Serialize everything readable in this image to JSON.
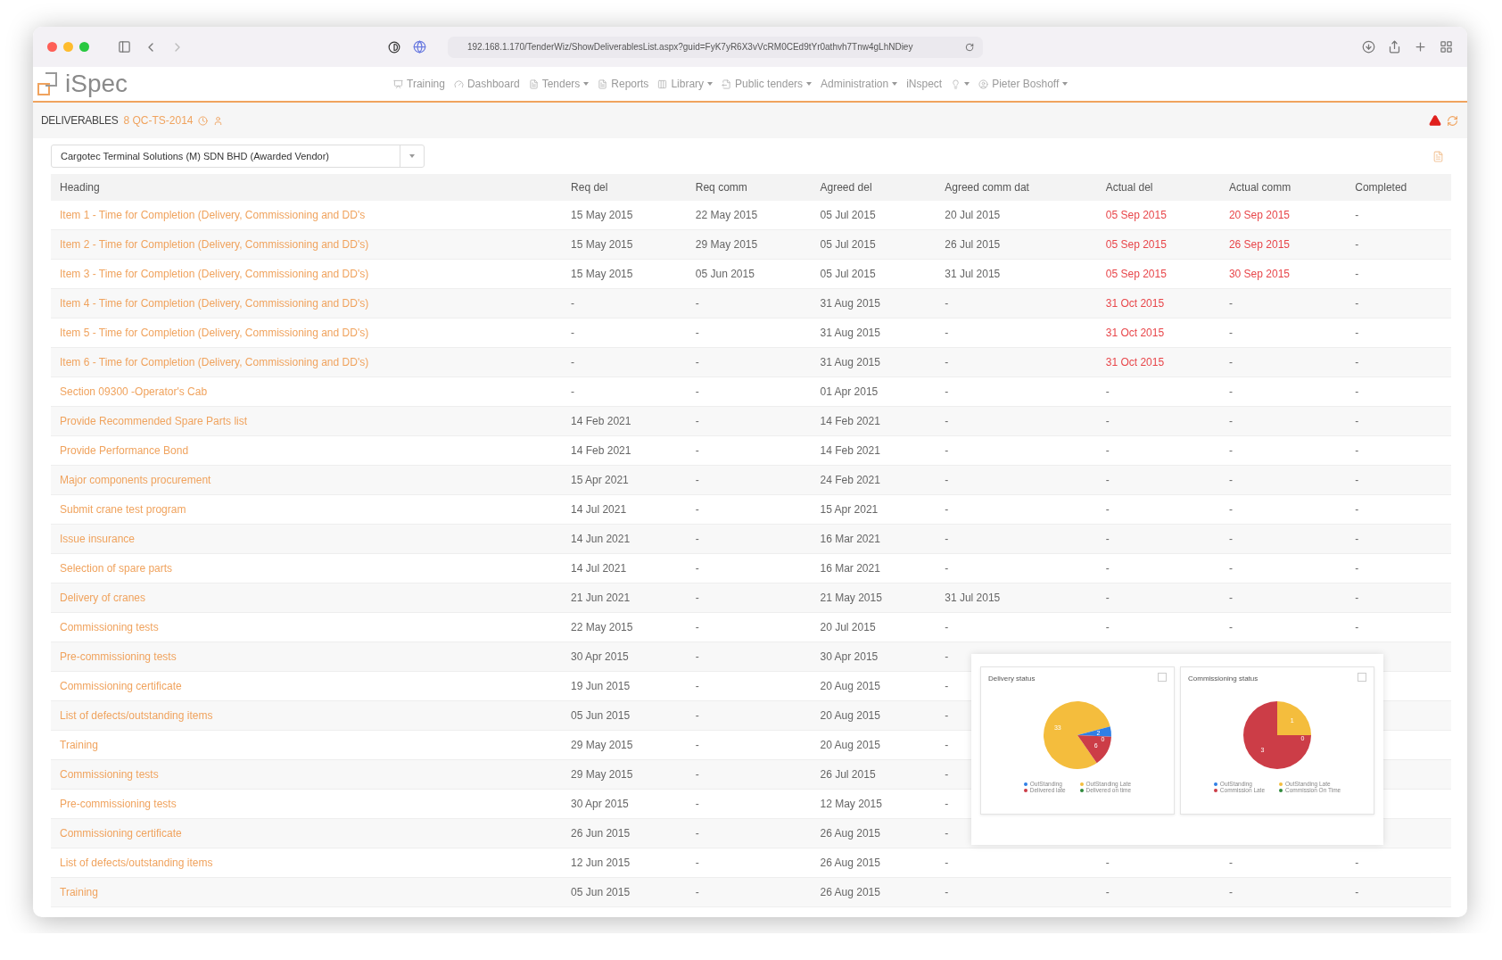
{
  "browser": {
    "url": "192.168.1.170/TenderWiz/ShowDeliverablesList.aspx?guid=FyK7yR6X3vVcRM0CEd9tYr0athvh7Tnw4gLhNDiey"
  },
  "nav": {
    "logo": "iSpec",
    "items": [
      {
        "label": "Training",
        "dropdown": false
      },
      {
        "label": "Dashboard",
        "dropdown": false
      },
      {
        "label": "Tenders",
        "dropdown": true
      },
      {
        "label": "Reports",
        "dropdown": false
      },
      {
        "label": "Library",
        "dropdown": true
      },
      {
        "label": "Public tenders",
        "dropdown": true
      },
      {
        "label": "Administration",
        "dropdown": true
      },
      {
        "label": "iNspect",
        "dropdown": false
      },
      {
        "dropdown": true
      },
      {
        "label": "Pieter Boshoff",
        "dropdown": true
      }
    ]
  },
  "page_header": {
    "title": "DELIVERABLES",
    "reference": "8 QC-TS-2014"
  },
  "vendor_select": {
    "value": "Cargotec Terminal Solutions (M) SDN BHD (Awarded Vendor)"
  },
  "table": {
    "heading_column": "Heading",
    "columns": [
      "Req del",
      "Req comm",
      "Agreed del",
      "Agreed comm dat",
      "Actual del",
      "Actual comm",
      "Completed"
    ],
    "rows": [
      {
        "heading": "Item 1 - Time for Completion (Delivery, Commissioning and DD's",
        "cells": [
          {
            "text": "15 May 2015",
            "overdue": false
          },
          {
            "text": "22 May 2015",
            "overdue": false
          },
          {
            "text": "05 Jul 2015",
            "overdue": false
          },
          {
            "text": "20 Jul 2015",
            "overdue": false
          },
          {
            "text": "05 Sep 2015",
            "overdue": true
          },
          {
            "text": "20 Sep 2015",
            "overdue": true
          },
          {
            "text": "-",
            "overdue": false
          }
        ]
      },
      {
        "heading": "Item 2 - Time for Completion (Delivery, Commissioning and DD's)",
        "cells": [
          {
            "text": "15 May 2015",
            "overdue": false
          },
          {
            "text": "29 May 2015",
            "overdue": false
          },
          {
            "text": "05 Jul 2015",
            "overdue": false
          },
          {
            "text": "26 Jul 2015",
            "overdue": false
          },
          {
            "text": "05 Sep 2015",
            "overdue": true
          },
          {
            "text": "26 Sep 2015",
            "overdue": true
          },
          {
            "text": "-",
            "overdue": false
          }
        ]
      },
      {
        "heading": "Item 3 - Time for Completion (Delivery, Commissioning and DD's)",
        "cells": [
          {
            "text": "15 May 2015",
            "overdue": false
          },
          {
            "text": "05 Jun 2015",
            "overdue": false
          },
          {
            "text": "05 Jul 2015",
            "overdue": false
          },
          {
            "text": "31 Jul 2015",
            "overdue": false
          },
          {
            "text": "05 Sep 2015",
            "overdue": true
          },
          {
            "text": "30 Sep 2015",
            "overdue": true
          },
          {
            "text": "-",
            "overdue": false
          }
        ]
      },
      {
        "heading": "Item 4 - Time for Completion (Delivery, Commissioning and DD's)",
        "cells": [
          {
            "text": "-",
            "overdue": false
          },
          {
            "text": "-",
            "overdue": false
          },
          {
            "text": "31 Aug 2015",
            "overdue": false
          },
          {
            "text": "-",
            "overdue": false
          },
          {
            "text": "31 Oct 2015",
            "overdue": true
          },
          {
            "text": "-",
            "overdue": false
          },
          {
            "text": "-",
            "overdue": false
          }
        ]
      },
      {
        "heading": "Item 5 - Time for Completion (Delivery, Commissioning and DD's)",
        "cells": [
          {
            "text": "-",
            "overdue": false
          },
          {
            "text": "-",
            "overdue": false
          },
          {
            "text": "31 Aug 2015",
            "overdue": false
          },
          {
            "text": "-",
            "overdue": false
          },
          {
            "text": "31 Oct 2015",
            "overdue": true
          },
          {
            "text": "-",
            "overdue": false
          },
          {
            "text": "-",
            "overdue": false
          }
        ]
      },
      {
        "heading": "Item 6 - Time for Completion (Delivery, Commissioning and DD's)",
        "cells": [
          {
            "text": "-",
            "overdue": false
          },
          {
            "text": "-",
            "overdue": false
          },
          {
            "text": "31 Aug 2015",
            "overdue": false
          },
          {
            "text": "-",
            "overdue": false
          },
          {
            "text": "31 Oct 2015",
            "overdue": true
          },
          {
            "text": "-",
            "overdue": false
          },
          {
            "text": "-",
            "overdue": false
          }
        ]
      },
      {
        "heading": "Section 09300 -Operator's Cab",
        "cells": [
          {
            "text": "-",
            "overdue": false
          },
          {
            "text": "-",
            "overdue": false
          },
          {
            "text": "01 Apr 2015",
            "overdue": false
          },
          {
            "text": "-",
            "overdue": false
          },
          {
            "text": "-",
            "overdue": false
          },
          {
            "text": "-",
            "overdue": false
          },
          {
            "text": "-",
            "overdue": false
          }
        ]
      },
      {
        "heading": "Provide Recommended Spare Parts list",
        "cells": [
          {
            "text": "14 Feb 2021",
            "overdue": false
          },
          {
            "text": "-",
            "overdue": false
          },
          {
            "text": "14 Feb 2021",
            "overdue": false
          },
          {
            "text": "-",
            "overdue": false
          },
          {
            "text": "-",
            "overdue": false
          },
          {
            "text": "-",
            "overdue": false
          },
          {
            "text": "-",
            "overdue": false
          }
        ]
      },
      {
        "heading": "Provide Performance Bond",
        "cells": [
          {
            "text": "14 Feb 2021",
            "overdue": false
          },
          {
            "text": "-",
            "overdue": false
          },
          {
            "text": "14 Feb 2021",
            "overdue": false
          },
          {
            "text": "-",
            "overdue": false
          },
          {
            "text": "-",
            "overdue": false
          },
          {
            "text": "-",
            "overdue": false
          },
          {
            "text": "-",
            "overdue": false
          }
        ]
      },
      {
        "heading": "Major components procurement",
        "cells": [
          {
            "text": "15 Apr 2021",
            "overdue": false
          },
          {
            "text": "-",
            "overdue": false
          },
          {
            "text": "24 Feb 2021",
            "overdue": false
          },
          {
            "text": "-",
            "overdue": false
          },
          {
            "text": "-",
            "overdue": false
          },
          {
            "text": "-",
            "overdue": false
          },
          {
            "text": "-",
            "overdue": false
          }
        ]
      },
      {
        "heading": "Submit crane test program",
        "cells": [
          {
            "text": "14 Jul 2021",
            "overdue": false
          },
          {
            "text": "-",
            "overdue": false
          },
          {
            "text": "15 Apr 2021",
            "overdue": false
          },
          {
            "text": "-",
            "overdue": false
          },
          {
            "text": "-",
            "overdue": false
          },
          {
            "text": "-",
            "overdue": false
          },
          {
            "text": "-",
            "overdue": false
          }
        ]
      },
      {
        "heading": "Issue insurance",
        "cells": [
          {
            "text": "14 Jun 2021",
            "overdue": false
          },
          {
            "text": "-",
            "overdue": false
          },
          {
            "text": "16 Mar 2021",
            "overdue": false
          },
          {
            "text": "-",
            "overdue": false
          },
          {
            "text": "-",
            "overdue": false
          },
          {
            "text": "-",
            "overdue": false
          },
          {
            "text": "-",
            "overdue": false
          }
        ]
      },
      {
        "heading": "Selection of spare parts",
        "cells": [
          {
            "text": "14 Jul 2021",
            "overdue": false
          },
          {
            "text": "-",
            "overdue": false
          },
          {
            "text": "16 Mar 2021",
            "overdue": false
          },
          {
            "text": "-",
            "overdue": false
          },
          {
            "text": "-",
            "overdue": false
          },
          {
            "text": "-",
            "overdue": false
          },
          {
            "text": "-",
            "overdue": false
          }
        ]
      },
      {
        "heading": "Delivery of cranes",
        "cells": [
          {
            "text": "21 Jun 2021",
            "overdue": false
          },
          {
            "text": "-",
            "overdue": false
          },
          {
            "text": "21 May 2015",
            "overdue": false
          },
          {
            "text": "31 Jul 2015",
            "overdue": false
          },
          {
            "text": "-",
            "overdue": false
          },
          {
            "text": "-",
            "overdue": false
          },
          {
            "text": "-",
            "overdue": false
          }
        ]
      },
      {
        "heading": "Commissioning tests",
        "cells": [
          {
            "text": "22 May 2015",
            "overdue": false
          },
          {
            "text": "-",
            "overdue": false
          },
          {
            "text": "20 Jul 2015",
            "overdue": false
          },
          {
            "text": "-",
            "overdue": false
          },
          {
            "text": "-",
            "overdue": false
          },
          {
            "text": "-",
            "overdue": false
          },
          {
            "text": "-",
            "overdue": false
          }
        ]
      },
      {
        "heading": "Pre-commissioning tests",
        "cells": [
          {
            "text": "30 Apr 2015",
            "overdue": false
          },
          {
            "text": "-",
            "overdue": false
          },
          {
            "text": "30 Apr 2015",
            "overdue": false
          },
          {
            "text": "-",
            "overdue": false
          }
        ]
      },
      {
        "heading": "Commissioning certificate",
        "cells": [
          {
            "text": "19 Jun 2015",
            "overdue": false
          },
          {
            "text": "-",
            "overdue": false
          },
          {
            "text": "20 Aug 2015",
            "overdue": false
          },
          {
            "text": "-",
            "overdue": false
          }
        ]
      },
      {
        "heading": "List of defects/outstanding items",
        "cells": [
          {
            "text": "05 Jun 2015",
            "overdue": false
          },
          {
            "text": "-",
            "overdue": false
          },
          {
            "text": "20 Aug 2015",
            "overdue": false
          },
          {
            "text": "-",
            "overdue": false
          }
        ]
      },
      {
        "heading": "Training",
        "cells": [
          {
            "text": "29 May 2015",
            "overdue": false
          },
          {
            "text": "-",
            "overdue": false
          },
          {
            "text": "20 Aug 2015",
            "overdue": false
          },
          {
            "text": "-",
            "overdue": false
          }
        ]
      },
      {
        "heading": "Commissioning tests",
        "cells": [
          {
            "text": "29 May 2015",
            "overdue": false
          },
          {
            "text": "-",
            "overdue": false
          },
          {
            "text": "26 Jul 2015",
            "overdue": false
          },
          {
            "text": "-",
            "overdue": false
          }
        ]
      },
      {
        "heading": "Pre-commissioning tests",
        "cells": [
          {
            "text": "30 Apr 2015",
            "overdue": false
          },
          {
            "text": "-",
            "overdue": false
          },
          {
            "text": "12 May 2015",
            "overdue": false
          },
          {
            "text": "-",
            "overdue": false
          }
        ]
      },
      {
        "heading": "Commissioning certificate",
        "cells": [
          {
            "text": "26 Jun 2015",
            "overdue": false
          },
          {
            "text": "-",
            "overdue": false
          },
          {
            "text": "26 Aug 2015",
            "overdue": false
          },
          {
            "text": "-",
            "overdue": false
          }
        ]
      },
      {
        "heading": "List of defects/outstanding items",
        "cells": [
          {
            "text": "12 Jun 2015",
            "overdue": false
          },
          {
            "text": "-",
            "overdue": false
          },
          {
            "text": "26 Aug 2015",
            "overdue": false
          },
          {
            "text": "-",
            "overdue": false
          },
          {
            "text": "-",
            "overdue": false
          },
          {
            "text": "-",
            "overdue": false
          },
          {
            "text": "-",
            "overdue": false
          }
        ]
      },
      {
        "heading": "Training",
        "cells": [
          {
            "text": "05 Jun 2015",
            "overdue": false
          },
          {
            "text": "-",
            "overdue": false
          },
          {
            "text": "26 Aug 2015",
            "overdue": false
          },
          {
            "text": "-",
            "overdue": false
          },
          {
            "text": "-",
            "overdue": false
          },
          {
            "text": "-",
            "overdue": false
          },
          {
            "text": "-",
            "overdue": false
          }
        ]
      }
    ]
  },
  "charts_panel": [
    {
      "chart_data": {
        "type": "pie",
        "title": "Delivery status",
        "categories": [
          "OutStanding",
          "OutStanding Late",
          "Delivered late",
          "Delivered on time"
        ],
        "values": [
          2,
          33,
          6,
          0
        ],
        "value_labels": [
          "2",
          "33",
          "6",
          "0"
        ],
        "colors": [
          "#2f7fe6",
          "#f4bd3d",
          "#cc3d47",
          "#2f8a3c"
        ]
      }
    },
    {
      "chart_data": {
        "type": "pie",
        "title": "Commissioning status",
        "categories": [
          "OutStanding",
          "OutStanding Late",
          "Commission Late",
          "Commission On Time"
        ],
        "values": [
          0,
          1,
          3,
          0
        ],
        "value_labels": [
          null,
          "1",
          "3",
          "0"
        ],
        "colors": [
          "#2f7fe6",
          "#f4bd3d",
          "#cc3d47",
          "#2f8a3c"
        ]
      }
    }
  ]
}
